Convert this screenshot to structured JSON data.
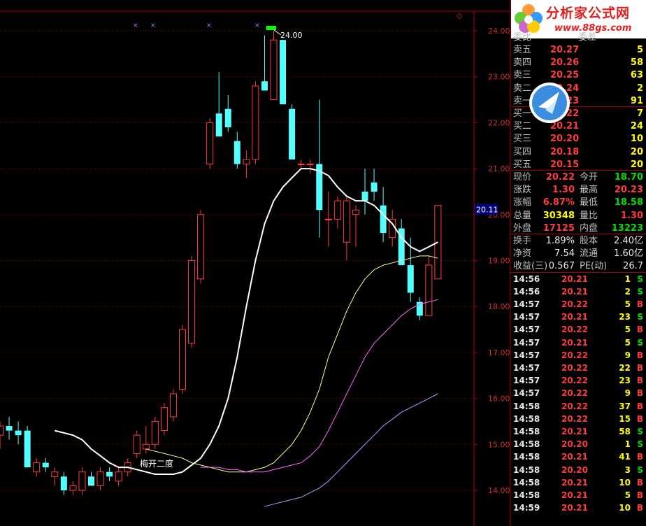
{
  "chart_data": {
    "type": "candlestick",
    "y_axis": {
      "ticks": [
        "24.00",
        "23.00",
        "22.00",
        "21.00",
        "20.00",
        "19.00",
        "18.00",
        "17.00",
        "16.00",
        "15.00",
        "14.00"
      ],
      "current_price_label": "20.11",
      "range": [
        13.6,
        24.5
      ]
    },
    "annotations": {
      "high_label": "24.00",
      "pattern_label": "梅开二度"
    },
    "candles": [
      {
        "o": 15.2,
        "h": 15.5,
        "l": 14.9,
        "c": 15.4
      },
      {
        "o": 15.4,
        "h": 15.6,
        "l": 15.1,
        "c": 15.3
      },
      {
        "o": 15.3,
        "h": 15.5,
        "l": 15.0,
        "c": 15.2
      },
      {
        "o": 15.3,
        "h": 15.4,
        "l": 14.5,
        "c": 14.5
      },
      {
        "o": 14.4,
        "h": 14.7,
        "l": 14.3,
        "c": 14.6
      },
      {
        "o": 14.6,
        "h": 14.7,
        "l": 14.4,
        "c": 14.5
      },
      {
        "o": 14.3,
        "h": 14.5,
        "l": 14.1,
        "c": 14.4
      },
      {
        "o": 14.3,
        "h": 14.4,
        "l": 13.9,
        "c": 14.0
      },
      {
        "o": 14.0,
        "h": 14.2,
        "l": 13.9,
        "c": 14.1
      },
      {
        "o": 14.0,
        "h": 14.5,
        "l": 13.9,
        "c": 14.4
      },
      {
        "o": 14.3,
        "h": 14.4,
        "l": 14.1,
        "c": 14.1
      },
      {
        "o": 14.1,
        "h": 14.5,
        "l": 14.0,
        "c": 14.4
      },
      {
        "o": 14.4,
        "h": 14.5,
        "l": 14.2,
        "c": 14.3
      },
      {
        "o": 14.2,
        "h": 14.5,
        "l": 14.1,
        "c": 14.4
      },
      {
        "o": 14.4,
        "h": 14.7,
        "l": 14.3,
        "c": 14.6
      },
      {
        "o": 14.8,
        "h": 15.3,
        "l": 14.7,
        "c": 15.2
      },
      {
        "o": 14.9,
        "h": 15.4,
        "l": 14.8,
        "c": 15.0
      },
      {
        "o": 15.0,
        "h": 15.6,
        "l": 14.9,
        "c": 15.5
      },
      {
        "o": 15.3,
        "h": 15.9,
        "l": 15.2,
        "c": 15.8
      },
      {
        "o": 15.6,
        "h": 16.2,
        "l": 15.5,
        "c": 16.1
      },
      {
        "o": 16.2,
        "h": 17.6,
        "l": 16.1,
        "c": 17.5
      },
      {
        "o": 17.2,
        "h": 19.1,
        "l": 17.1,
        "c": 19.0
      },
      {
        "o": 18.6,
        "h": 20.1,
        "l": 18.5,
        "c": 20.0
      },
      {
        "o": 21.1,
        "h": 22.1,
        "l": 21.0,
        "c": 22.0
      },
      {
        "o": 22.2,
        "h": 23.1,
        "l": 21.8,
        "c": 21.7
      },
      {
        "o": 22.3,
        "h": 22.6,
        "l": 21.8,
        "c": 21.9
      },
      {
        "o": 21.6,
        "h": 21.8,
        "l": 21.0,
        "c": 21.1
      },
      {
        "o": 21.1,
        "h": 21.4,
        "l": 20.8,
        "c": 21.2
      },
      {
        "o": 21.2,
        "h": 22.9,
        "l": 21.1,
        "c": 22.8
      },
      {
        "o": 22.9,
        "h": 23.9,
        "l": 22.7,
        "c": 22.7
      },
      {
        "o": 22.5,
        "h": 24.0,
        "l": 22.5,
        "c": 23.8
      },
      {
        "o": 23.8,
        "h": 23.8,
        "l": 22.4,
        "c": 22.4
      },
      {
        "o": 22.3,
        "h": 22.4,
        "l": 21.2,
        "c": 21.2
      },
      {
        "o": 21.1,
        "h": 21.2,
        "l": 21.0,
        "c": 21.1
      },
      {
        "o": 21.1,
        "h": 21.2,
        "l": 20.9,
        "c": 21.1
      },
      {
        "o": 21.1,
        "h": 22.5,
        "l": 19.5,
        "c": 20.1
      },
      {
        "o": 19.9,
        "h": 20.5,
        "l": 19.3,
        "c": 19.9
      },
      {
        "o": 19.9,
        "h": 20.4,
        "l": 19.7,
        "c": 20.3
      },
      {
        "o": 19.4,
        "h": 20.4,
        "l": 19.0,
        "c": 20.3
      },
      {
        "o": 20.0,
        "h": 20.2,
        "l": 19.3,
        "c": 20.1
      },
      {
        "o": 20.5,
        "h": 21.0,
        "l": 20.0,
        "c": 20.3
      },
      {
        "o": 20.7,
        "h": 21.0,
        "l": 20.3,
        "c": 20.5
      },
      {
        "o": 20.2,
        "h": 20.6,
        "l": 19.4,
        "c": 19.6
      },
      {
        "o": 19.5,
        "h": 20.1,
        "l": 19.3,
        "c": 19.9
      },
      {
        "o": 19.7,
        "h": 19.9,
        "l": 18.9,
        "c": 18.9
      },
      {
        "o": 18.9,
        "h": 19.5,
        "l": 18.1,
        "c": 18.3
      },
      {
        "o": 18.1,
        "h": 18.2,
        "l": 17.7,
        "c": 17.8
      },
      {
        "o": 17.8,
        "h": 19.1,
        "l": 17.8,
        "c": 18.9
      },
      {
        "o": 18.6,
        "h": 20.2,
        "l": 18.6,
        "c": 20.2
      }
    ],
    "ma_lines": [
      {
        "name": "MA5",
        "color": "#ffffff",
        "values": [
          15.3,
          15.25,
          15.2,
          15.1,
          14.9,
          14.75,
          14.6,
          14.5,
          14.5,
          14.45,
          14.4,
          14.35,
          14.35,
          14.35,
          14.4,
          14.55,
          14.7,
          15.0,
          15.4,
          16.0,
          16.9,
          18.0,
          19.0,
          19.8,
          20.3,
          20.6,
          20.8,
          21.0,
          21.0,
          20.95,
          20.85,
          20.6,
          20.4,
          20.3,
          20.3,
          20.2,
          20.0,
          19.8,
          19.5,
          19.3,
          19.2,
          19.3,
          19.4
        ]
      },
      {
        "name": "MA10",
        "color": "#ffff99",
        "values": [
          14.9,
          14.85,
          14.8,
          14.75,
          14.7,
          14.6,
          14.55,
          14.5,
          14.45,
          14.4,
          14.4,
          14.4,
          14.45,
          14.5,
          14.6,
          14.8,
          15.0,
          15.3,
          15.7,
          16.2,
          16.9,
          17.4,
          17.9,
          18.3,
          18.6,
          18.8,
          18.9,
          18.95,
          19.0,
          19.05,
          19.1,
          19.1,
          19.05
        ]
      },
      {
        "name": "MA20",
        "color": "#ff66ff",
        "values": [
          14.5,
          14.5,
          14.5,
          14.45,
          14.45,
          14.4,
          14.4,
          14.4,
          14.45,
          14.5,
          14.55,
          14.6,
          14.75,
          14.95,
          15.3,
          15.7,
          16.1,
          16.5,
          16.9,
          17.2,
          17.4,
          17.6,
          17.8,
          17.95,
          18.05,
          18.1,
          18.15
        ]
      },
      {
        "name": "MA60",
        "color": "#99aaff",
        "values": [
          13.65,
          13.7,
          13.75,
          13.8,
          13.85,
          13.95,
          14.05,
          14.2,
          14.4,
          14.6,
          14.8,
          15.0,
          15.2,
          15.4,
          15.55,
          15.7,
          15.8,
          15.9,
          16.0,
          16.1
        ]
      }
    ]
  },
  "panel": {
    "header": {
      "left": "委比",
      "mid": "委差"
    },
    "asks": [
      {
        "label": "卖五",
        "price": "20.27",
        "vol": "5"
      },
      {
        "label": "卖四",
        "price": "20.26",
        "vol": "58"
      },
      {
        "label": "卖三",
        "price": "20.25",
        "vol": "63"
      },
      {
        "label": "卖二",
        "price": "20.24",
        "vol": "2"
      },
      {
        "label": "卖一",
        "price": "20.23",
        "vol": "91"
      }
    ],
    "bids": [
      {
        "label": "买一",
        "price": "20.22",
        "vol": "7"
      },
      {
        "label": "买二",
        "price": "20.21",
        "vol": "24"
      },
      {
        "label": "买三",
        "price": "20.20",
        "vol": "10"
      },
      {
        "label": "买四",
        "price": "20.18",
        "vol": "20"
      },
      {
        "label": "买五",
        "price": "20.15",
        "vol": "20"
      }
    ],
    "quote": [
      {
        "l1": "现价",
        "v1": "20.22",
        "l2": "今开",
        "v2": "18.70"
      },
      {
        "l1": "涨跌",
        "v1": "1.30",
        "l2": "最高",
        "v2": "20.23"
      },
      {
        "l1": "涨幅",
        "v1": "6.87%",
        "l2": "最低",
        "v2": "18.58"
      },
      {
        "l1": "总量",
        "v1": "30348",
        "l2": "量比",
        "v2": "1.30"
      },
      {
        "l1": "外盘",
        "v1": "17125",
        "l2": "内盘",
        "v2": "13223"
      }
    ],
    "fund": [
      {
        "l1": "换手",
        "v1": "1.89%",
        "l2": "股本",
        "v2": "2.40亿"
      },
      {
        "l1": "净资",
        "v1": "7.54",
        "l2": "流通",
        "v2": "1.60亿"
      },
      {
        "l1": "收益(三)",
        "v1": "0.567",
        "l2": "PE(动)",
        "v2": "26.7"
      }
    ],
    "ticks": [
      {
        "t": "14:56",
        "p": "20.21",
        "v": "1",
        "bs": "S"
      },
      {
        "t": "14:56",
        "p": "20.21",
        "v": "2",
        "bs": "S"
      },
      {
        "t": "14:57",
        "p": "20.22",
        "v": "5",
        "bs": "B"
      },
      {
        "t": "14:57",
        "p": "20.21",
        "v": "23",
        "bs": "S"
      },
      {
        "t": "14:57",
        "p": "20.22",
        "v": "5",
        "bs": "B"
      },
      {
        "t": "14:57",
        "p": "20.21",
        "v": "5",
        "bs": "S"
      },
      {
        "t": "14:57",
        "p": "20.22",
        "v": "9",
        "bs": "B"
      },
      {
        "t": "14:57",
        "p": "20.22",
        "v": "22",
        "bs": "B"
      },
      {
        "t": "14:57",
        "p": "20.22",
        "v": "23",
        "bs": "B"
      },
      {
        "t": "14:57",
        "p": "20.22",
        "v": "9",
        "bs": "B"
      },
      {
        "t": "14:58",
        "p": "20.22",
        "v": "37",
        "bs": "B"
      },
      {
        "t": "14:58",
        "p": "20.22",
        "v": "15",
        "bs": "B"
      },
      {
        "t": "14:58",
        "p": "20.21",
        "v": "58",
        "bs": "S"
      },
      {
        "t": "14:58",
        "p": "20.20",
        "v": "1",
        "bs": "S"
      },
      {
        "t": "14:58",
        "p": "20.21",
        "v": "41",
        "bs": "B"
      },
      {
        "t": "14:58",
        "p": "20.20",
        "v": "3",
        "bs": "S"
      },
      {
        "t": "14:58",
        "p": "20.21",
        "v": "10",
        "bs": "B"
      },
      {
        "t": "14:58",
        "p": "20.21",
        "v": "5",
        "bs": "B"
      },
      {
        "t": "14:59",
        "p": "20.21",
        "v": "10",
        "bs": "B"
      }
    ],
    "logo": {
      "name": "分析家公式网",
      "url": "www.88gs.com"
    }
  },
  "colors": {
    "up": "#ff3c3c",
    "down": "#54ffff",
    "grid": "#8b0000",
    "axis": "#b00000"
  }
}
